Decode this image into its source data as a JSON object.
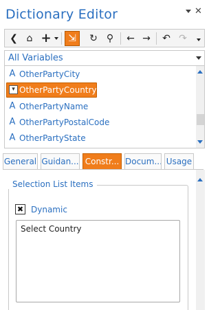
{
  "window": {
    "title": "Dictionary Editor"
  },
  "toolbar": {
    "items": [
      {
        "name": "back",
        "icon": "circle-back-icon",
        "glyph": "❮"
      },
      {
        "name": "home",
        "icon": "home-icon",
        "glyph": "⌂"
      },
      {
        "name": "add",
        "icon": "plus-icon",
        "glyph": "+"
      },
      {
        "name": "insert",
        "icon": "insert-field-icon",
        "glyph": "⇲"
      },
      {
        "name": "refresh",
        "icon": "refresh-icon",
        "glyph": "↻"
      },
      {
        "name": "search",
        "icon": "search-icon",
        "glyph": "⚲"
      },
      {
        "name": "previous",
        "icon": "arrow-left-icon",
        "glyph": "←"
      },
      {
        "name": "next",
        "icon": "arrow-right-icon",
        "glyph": "→"
      },
      {
        "name": "undo",
        "icon": "undo-icon",
        "glyph": "↶"
      },
      {
        "name": "redo",
        "icon": "redo-icon",
        "glyph": "↷"
      }
    ]
  },
  "variables": {
    "filter_label": "All Variables",
    "items": [
      {
        "label": "OtherPartyCity",
        "icon": "text-variable-icon",
        "glyph": "A",
        "selected": false
      },
      {
        "label": "OtherPartyCountry",
        "icon": "list-variable-icon",
        "glyph": "▾",
        "selected": true
      },
      {
        "label": "OtherPartyName",
        "icon": "text-variable-icon",
        "glyph": "A",
        "selected": false
      },
      {
        "label": "OtherPartyPostalCode",
        "icon": "text-variable-icon",
        "glyph": "A",
        "selected": false
      },
      {
        "label": "OtherPartyState",
        "icon": "text-variable-icon",
        "glyph": "A",
        "selected": false
      }
    ]
  },
  "tabs": [
    {
      "label": "General",
      "active": false
    },
    {
      "label": "Guidan...",
      "active": false
    },
    {
      "label": "Constr...",
      "active": true
    },
    {
      "label": "Docum...",
      "active": false
    },
    {
      "label": "Usage",
      "active": false
    }
  ],
  "constraints": {
    "group_label": "Selection List Items",
    "dynamic_label": "Dynamic",
    "dynamic_checked": true,
    "checkbox_mark": "✖",
    "text_value": "Select Country"
  },
  "colors": {
    "accent": "#f07d1b",
    "text_blue": "#2a6fc0"
  }
}
